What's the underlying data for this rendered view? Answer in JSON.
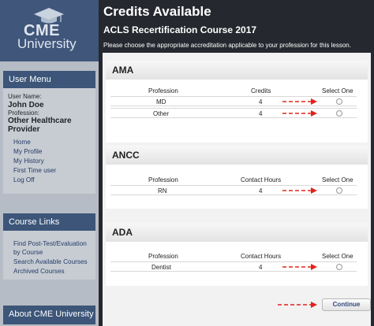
{
  "logo": {
    "line1": "CME",
    "line2": "University"
  },
  "sidebar": {
    "user_menu_title": "User Menu",
    "user_name_label": "User Name:",
    "user_name": "John Doe",
    "profession_label": "Profession:",
    "profession_line1": "Other Healthcare",
    "profession_line2": "Provider",
    "menu_items": [
      "Home",
      "My Profile",
      "My History",
      "First Time user",
      "Log Off"
    ],
    "course_links_title": "Course Links",
    "course_links": [
      "Find Post-Test/Evaluation",
      "by Course",
      "Search Available Courses",
      "Archived Courses"
    ],
    "about_title": "About CME University"
  },
  "main": {
    "title": "Credits Available",
    "course": "ACLS Recertification Course 2017",
    "instruction": "Please choose the appropriate accreditation applicable to your profession for this lesson."
  },
  "sections": [
    {
      "name": "AMA",
      "headers": [
        "Profession",
        "Credits",
        "Select One"
      ],
      "rows": [
        {
          "profession": "MD",
          "value": "4"
        },
        {
          "profession": "Other",
          "value": "4"
        }
      ]
    },
    {
      "name": "ANCC",
      "headers": [
        "Profession",
        "Contact Hours",
        "Select One"
      ],
      "rows": [
        {
          "profession": "RN",
          "value": "4"
        }
      ]
    },
    {
      "name": "ADA",
      "headers": [
        "Profession",
        "Contact Hours",
        "Select One"
      ],
      "rows": [
        {
          "profession": "Dentist",
          "value": "4"
        }
      ]
    }
  ],
  "continue_label": "Continue",
  "colors": {
    "sidebar_header": "#3c5579",
    "background": "#25282e",
    "arrow": "#e0231c"
  }
}
